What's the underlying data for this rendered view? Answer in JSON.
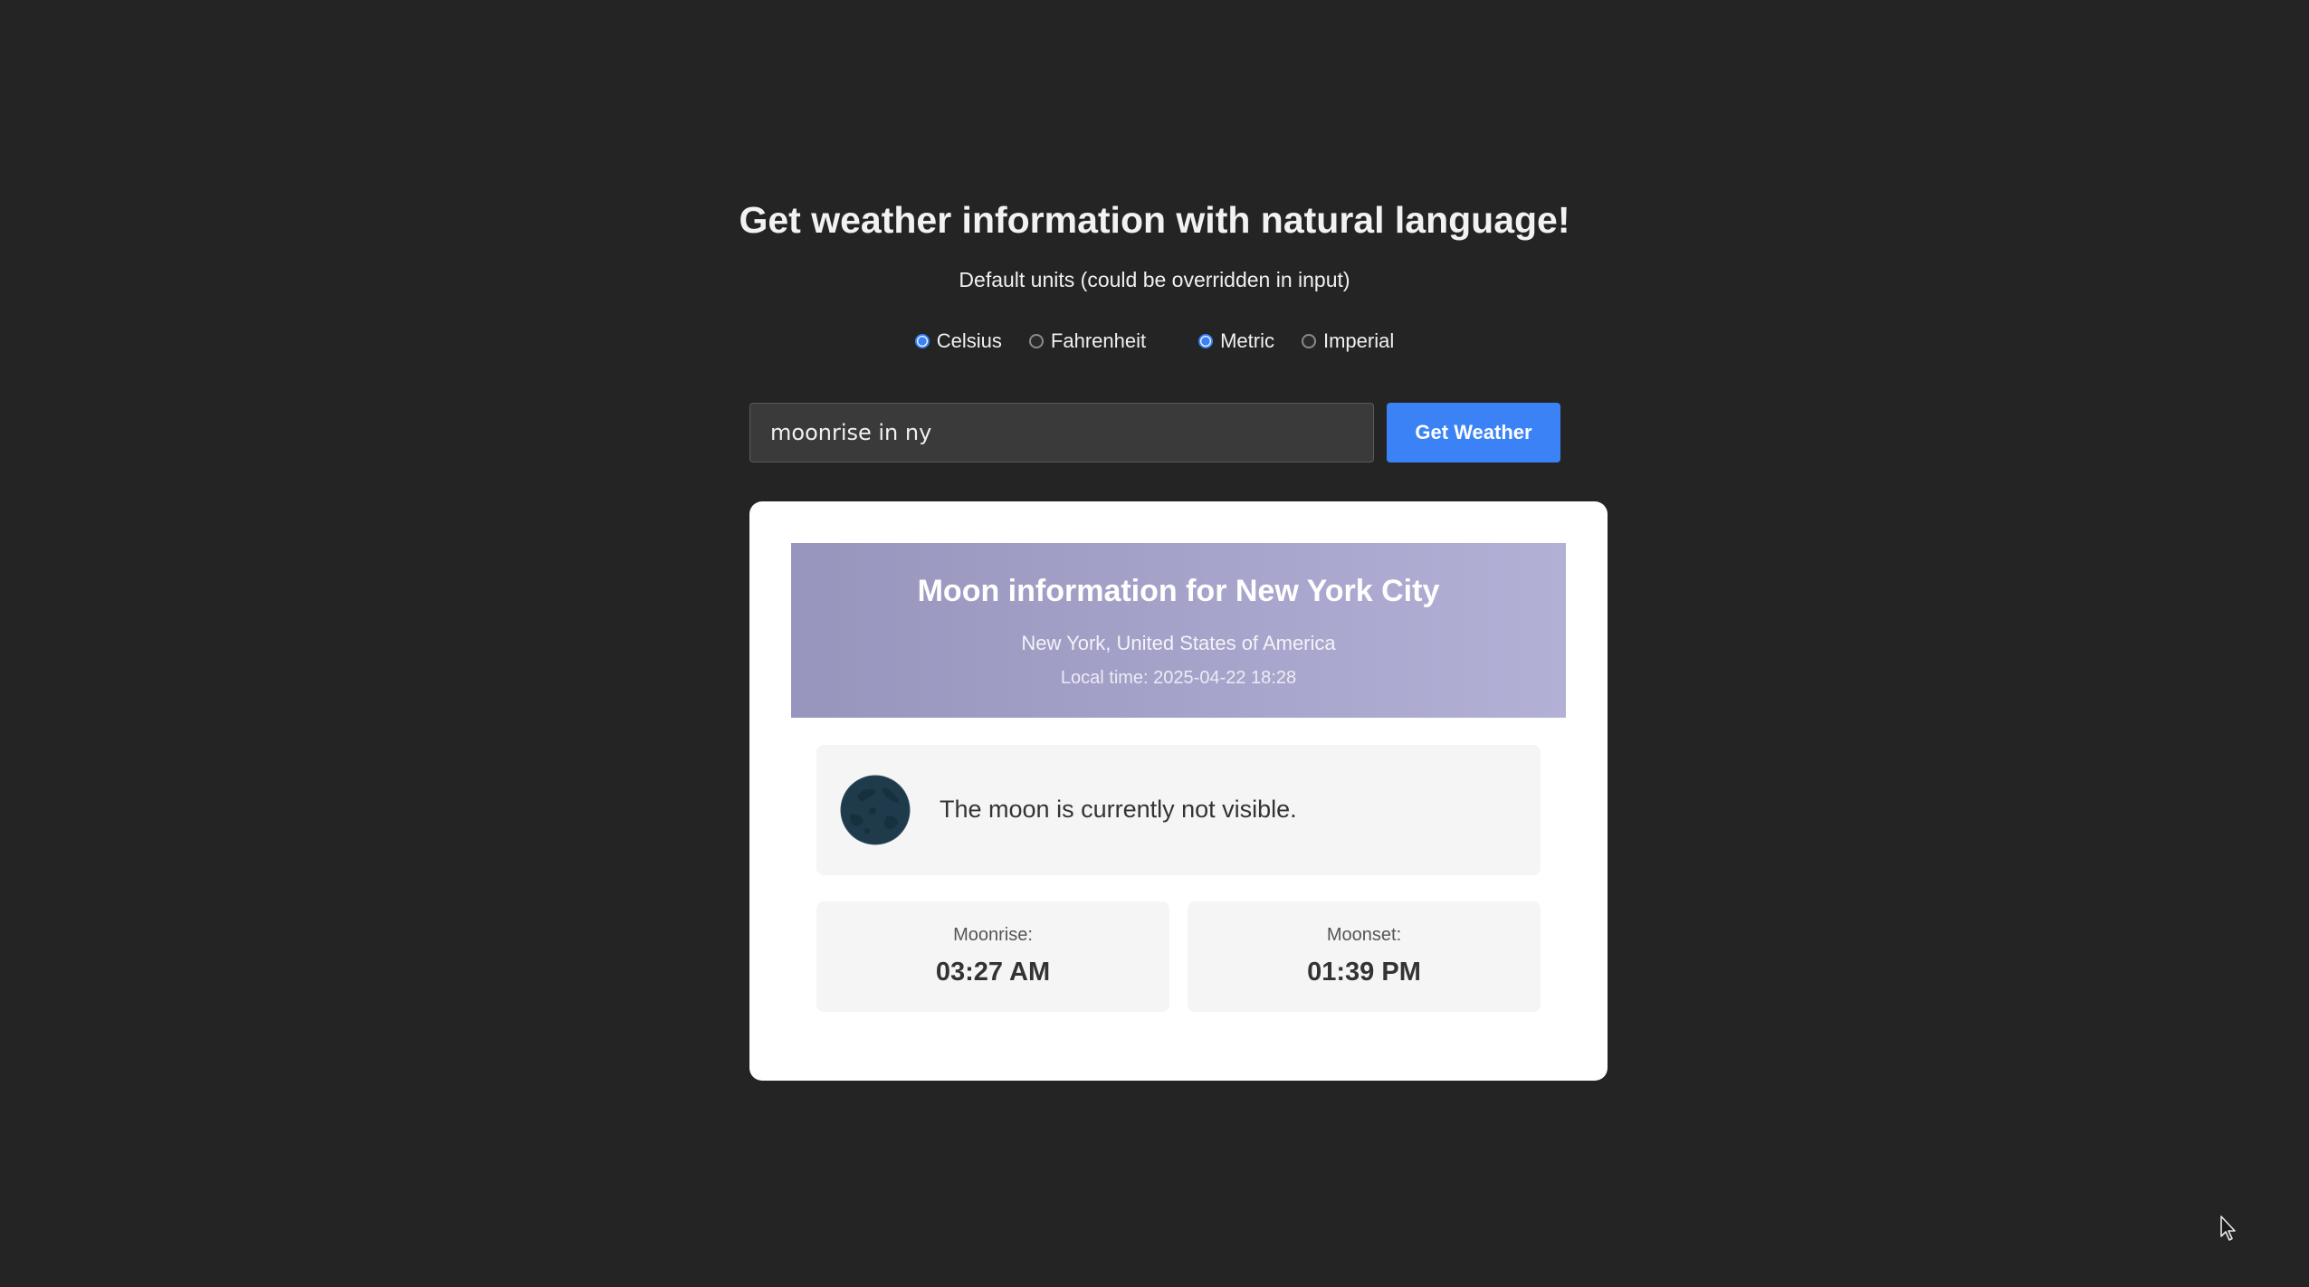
{
  "header": {
    "title": "Get weather information with natural language!",
    "subtitle": "Default units (could be overridden in input)"
  },
  "units": {
    "temperature": {
      "options": [
        "Celsius",
        "Fahrenheit"
      ],
      "selected": "Celsius"
    },
    "system": {
      "options": [
        "Metric",
        "Imperial"
      ],
      "selected": "Metric"
    }
  },
  "search": {
    "value": "moonrise in ny",
    "button_label": "Get Weather"
  },
  "result": {
    "title": "Moon information for New York City",
    "location": "New York, United States of America",
    "local_time": "Local time: 2025-04-22 18:28",
    "visibility_message": "The moon is currently not visible.",
    "moonrise": {
      "label": "Moonrise:",
      "value": "03:27 AM"
    },
    "moonset": {
      "label": "Moonset:",
      "value": "01:39 PM"
    }
  },
  "colors": {
    "background": "#242424",
    "accent": "#3b82f6",
    "header_gradient_start": "#9795bd",
    "header_gradient_end": "#b3b0d6",
    "moon_icon": "#1f3a4a"
  },
  "icons": {
    "moon": "moon-icon",
    "cursor": "mouse-cursor-icon"
  }
}
